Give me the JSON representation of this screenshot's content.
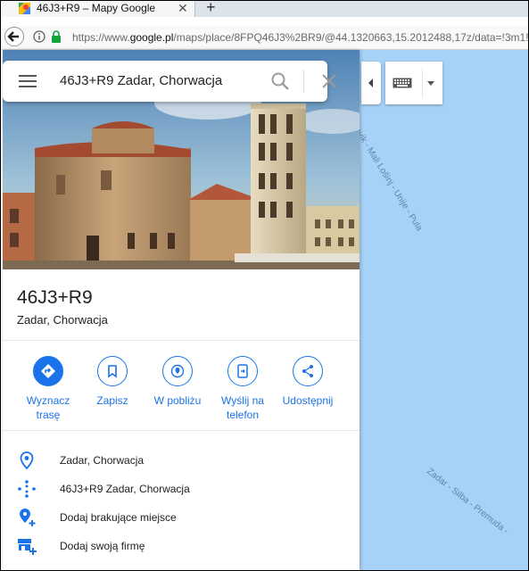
{
  "browser": {
    "tab_title": "46J3+R9 – Mapy Google",
    "url_prefix": "https://www.",
    "url_host": "google.pl",
    "url_rest": "/maps/place/8FPQ46J3%2BR9/@44.1320663,15.2012488,17z/data=!3m1!4b",
    "new_tab": "+",
    "close_tab": "✕"
  },
  "search": {
    "query": "46J3+R9 Zadar, Chorwacja"
  },
  "place": {
    "title": "46J3+R9",
    "subtitle": "Zadar, Chorwacja"
  },
  "actions": [
    {
      "label": "Wyznacz trasę",
      "icon": "directions-icon"
    },
    {
      "label": "Zapisz",
      "icon": "bookmark-icon"
    },
    {
      "label": "W pobliżu",
      "icon": "nearby-icon"
    },
    {
      "label": "Wyślij na telefon",
      "icon": "send-to-phone-icon"
    },
    {
      "label": "Udostępnij",
      "icon": "share-icon"
    }
  ],
  "info": [
    {
      "text": "Zadar, Chorwacja",
      "icon": "pin-icon"
    },
    {
      "text": "46J3+R9 Zadar, Chorwacja",
      "icon": "plus-code-icon"
    },
    {
      "text": "Dodaj brakujące miejsce",
      "icon": "add-place-icon"
    },
    {
      "text": "Dodaj swoją firmę",
      "icon": "add-business-icon"
    }
  ],
  "map": {
    "label_route1": "ovik - Mali Lošinj - Unije - Pula",
    "label_route2": "Zadar - Silba - Premuda -"
  },
  "colors": {
    "accent": "#1a73e8",
    "water": "#a7d2f8"
  }
}
